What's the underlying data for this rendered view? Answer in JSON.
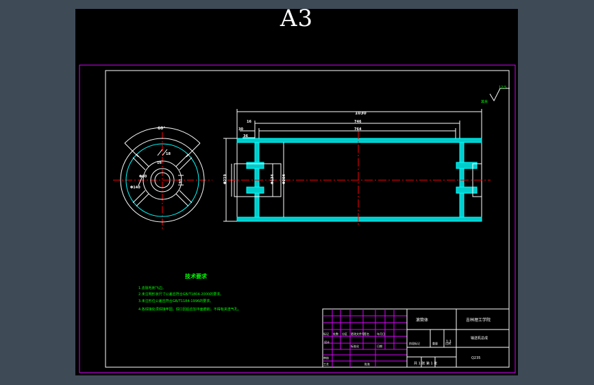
{
  "sheet": {
    "size_label": "A3"
  },
  "drawing": {
    "surface_finish": "12.5",
    "surface_finish_note": "其余",
    "dims": {
      "overall_length": "1030",
      "inner_length": "746",
      "inner_length_2": "764",
      "left_offset": "16",
      "flange_a": "30",
      "flange_b": "36",
      "outer_dia": "Φ219",
      "bore_dia": "Φ134",
      "inner_dia": "Φ204",
      "angle": "60°",
      "rib_1": "18",
      "rib_2": "16",
      "hub_1": "Φ60",
      "hub_2": "Φ140",
      "hub_3": "16"
    }
  },
  "requirements": {
    "title": "技术要求",
    "items": [
      "1.去除毛刺飞边。",
      "2.未注明形状尺寸公差应符合GB/T1804-2000的要求。",
      "3.未注形位公差应符合GB/T1184-1996的要求。",
      "4.各焊接处须焊接牢固，焊口回后应加平面磨削，不得有夹渣气孔。"
    ]
  },
  "title_block": {
    "part_name": "滚筒体",
    "school": "吉林理工学院",
    "drawing_no": "输送机总成",
    "material": "Q235",
    "scale": "1:1",
    "sheet_info": "共 1 张  第 1 张",
    "drawn_by": "设计",
    "labels": [
      "标记",
      "处数",
      "分区",
      "更改文件号",
      "签名",
      "年月日",
      "阶段标记",
      "重量",
      "比例",
      "审核",
      "工艺",
      "批准",
      "标准化",
      "日期"
    ]
  }
}
